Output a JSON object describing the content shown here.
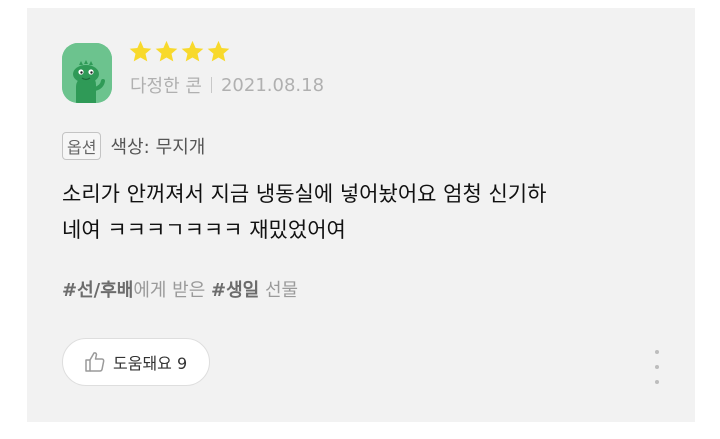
{
  "review": {
    "rating": 4,
    "max_rating": 4,
    "reviewer": "다정한 콘",
    "date": "2021.08.18",
    "option_badge": "옵션",
    "option_label": "색상:",
    "option_value": "무지개",
    "text": "소리가 안꺼져서 지금 냉동실에 넣어놨어요 엄청 신기하\n네여 ㅋㅋㅋㄱㅋㅋㅋ 재밌었어여",
    "tags": [
      {
        "parts": [
          {
            "text": "#선/후배",
            "bold": true
          },
          {
            "text": "에게 받은 ",
            "bold": false
          }
        ]
      },
      {
        "parts": [
          {
            "text": "#생일",
            "bold": true
          },
          {
            "text": " 선물",
            "bold": false
          }
        ]
      }
    ],
    "helpful_label": "도움돼요 9"
  },
  "colors": {
    "star": "#f8d92c",
    "avatar_bg": "#6cc38e",
    "card_bg": "#f2f2f2"
  },
  "icons": {
    "avatar": "green-dinosaur-avatar",
    "helpful": "thumbs-up-icon",
    "more": "more-vertical-icon"
  }
}
